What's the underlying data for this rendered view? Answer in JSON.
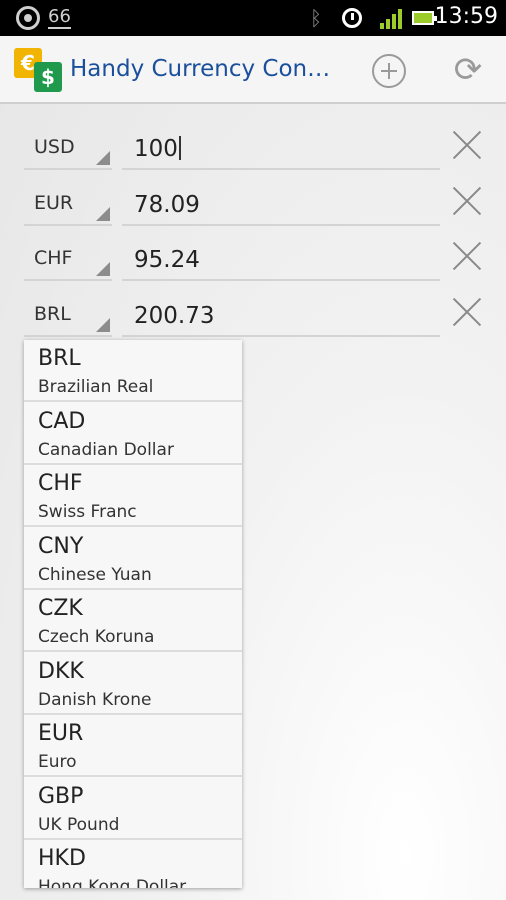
{
  "status_bar": {
    "notification_count": "66",
    "time": "13:59",
    "icons": [
      "app-notification-icon",
      "bluetooth-icon",
      "alarm-icon",
      "signal-icon",
      "battery-icon"
    ]
  },
  "action_bar": {
    "title": "Handy Currency Con…",
    "logo_eur_symbol": "€",
    "logo_usd_symbol": "$",
    "add_icon": "add-circle-icon",
    "refresh_icon": "refresh-icon",
    "refresh_glyph": "⟳"
  },
  "converter_rows": [
    {
      "currency": "USD",
      "amount": "100"
    },
    {
      "currency": "EUR",
      "amount": "78.09"
    },
    {
      "currency": "CHF",
      "amount": "95.24"
    },
    {
      "currency": "BRL",
      "amount": "200.73"
    }
  ],
  "dropdown": {
    "items": [
      {
        "code": "BRL",
        "name": "Brazilian Real"
      },
      {
        "code": "CAD",
        "name": "Canadian Dollar"
      },
      {
        "code": "CHF",
        "name": "Swiss Franc"
      },
      {
        "code": "CNY",
        "name": "Chinese Yuan"
      },
      {
        "code": "CZK",
        "name": "Czech Koruna"
      },
      {
        "code": "DKK",
        "name": "Danish Krone"
      },
      {
        "code": "EUR",
        "name": "Euro"
      },
      {
        "code": "GBP",
        "name": "UK Pound"
      },
      {
        "code": "HKD",
        "name": "Hong Kong Dollar"
      }
    ]
  },
  "colors": {
    "title_blue": "#1a4f9c",
    "signal_green": "#9ccc2c",
    "logo_yellow": "#f1b400",
    "logo_green": "#1f9a4c"
  }
}
